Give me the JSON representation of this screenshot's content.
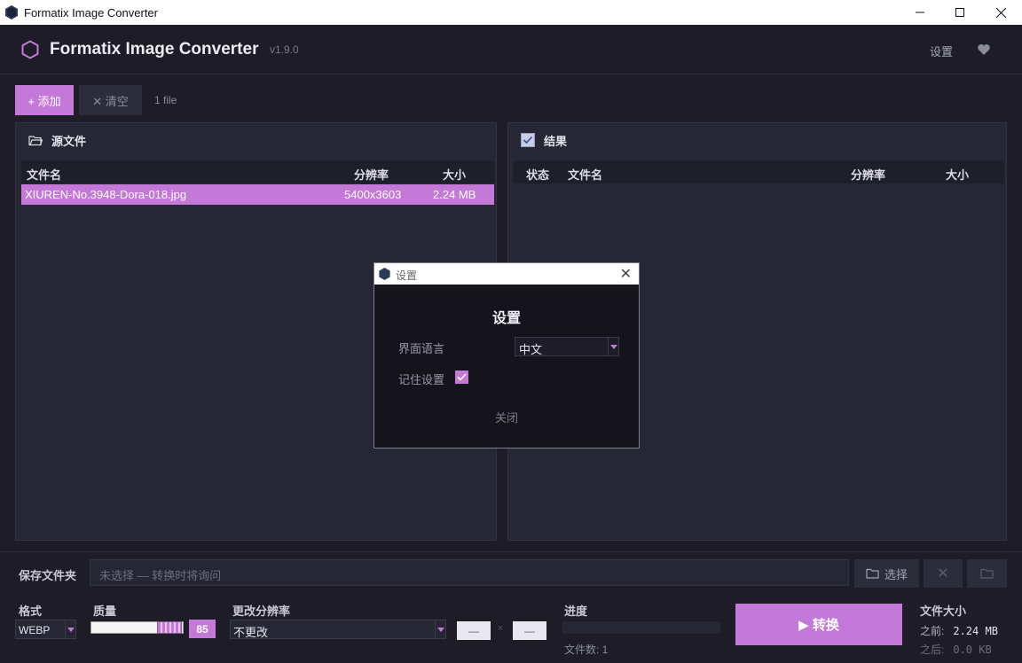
{
  "window": {
    "title": "Formatix Image Converter",
    "minimize": "—",
    "maximize": "☐",
    "close": "✕"
  },
  "header": {
    "app_name": "Formatix Image Converter",
    "version": "v1.9.0",
    "settings_label": "设置"
  },
  "toolbar": {
    "add_label": "+ 添加",
    "clear_label": "✕ 清空",
    "file_count": "1 file"
  },
  "source_panel": {
    "title": "源文件",
    "columns": [
      "文件名",
      "分辨率",
      "大小"
    ],
    "rows": [
      {
        "name": "XIUREN-No.3948-Dora-018.jpg",
        "resolution": "5400x3603",
        "size": "2.24 MB"
      }
    ]
  },
  "result_panel": {
    "title": "结果",
    "columns": [
      "状态",
      "文件名",
      "分辨率",
      "大小"
    ]
  },
  "settings_dialog": {
    "window_title": "设置",
    "heading": "设置",
    "language_label": "界面语言",
    "language_value": "中文",
    "remember_label": "记住设置",
    "remember_checked": true,
    "close_label": "关闭"
  },
  "output": {
    "save_folder_label": "保存文件夹",
    "save_folder_placeholder": "未选择 — 转换时将询问",
    "choose_label": "选择",
    "clear_icon": "✕"
  },
  "options": {
    "format_label": "格式",
    "format_value": "WEBP",
    "quality_label": "质量",
    "quality_value": "85",
    "resize_label": "更改分辨率",
    "resize_value": "不更改",
    "width_value": "—",
    "height_value": "—",
    "times": "×",
    "progress_label": "进度",
    "progress": 0,
    "file_count_label": "文件数: 1",
    "convert_label": "▶  转换",
    "size_label": "文件大小",
    "before_label": "之前:",
    "before_value": "2.24 MB",
    "after_label": "之后:",
    "after_value": "0.0 KB"
  },
  "colors": {
    "accent": "#c479d8",
    "bg": "#1d1c27",
    "panel": "#272635"
  }
}
